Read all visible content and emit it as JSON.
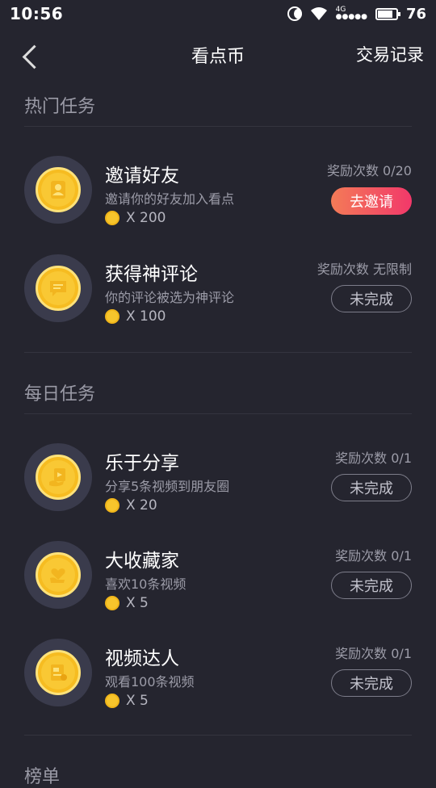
{
  "status_bar": {
    "time": "10:56",
    "network": "4G",
    "battery": "76"
  },
  "header": {
    "title": "看点币",
    "records_label": "交易记录"
  },
  "sections": {
    "hot": {
      "title": "热门任务",
      "tasks": [
        {
          "name": "邀请好友",
          "desc": "邀请你的好友加入看点",
          "reward": "X 200",
          "count": "奖励次数 0/20",
          "action": "去邀请",
          "icon": "user-icon"
        },
        {
          "name": "获得神评论",
          "desc": "你的评论被选为神评论",
          "reward": "X 100",
          "count": "奖励次数 无限制",
          "action": "未完成",
          "icon": "comment-icon"
        }
      ]
    },
    "daily": {
      "title": "每日任务",
      "tasks": [
        {
          "name": "乐于分享",
          "desc": "分享5条视频到朋友圈",
          "reward": "X 20",
          "count": "奖励次数 0/1",
          "action": "未完成",
          "icon": "share-icon"
        },
        {
          "name": "大收藏家",
          "desc": "喜欢10条视频",
          "reward": "X 5",
          "count": "奖励次数 0/1",
          "action": "未完成",
          "icon": "heart-hand-icon"
        },
        {
          "name": "视频达人",
          "desc": "观看100条视频",
          "reward": "X 5",
          "count": "奖励次数 0/1",
          "action": "未完成",
          "icon": "video-icon"
        }
      ]
    },
    "ranking": {
      "title": "榜单"
    }
  },
  "colors": {
    "background": "#25252f",
    "accent_gradient_start": "#f37b57",
    "accent_gradient_end": "#f2386a",
    "coin": "#f9c834"
  }
}
